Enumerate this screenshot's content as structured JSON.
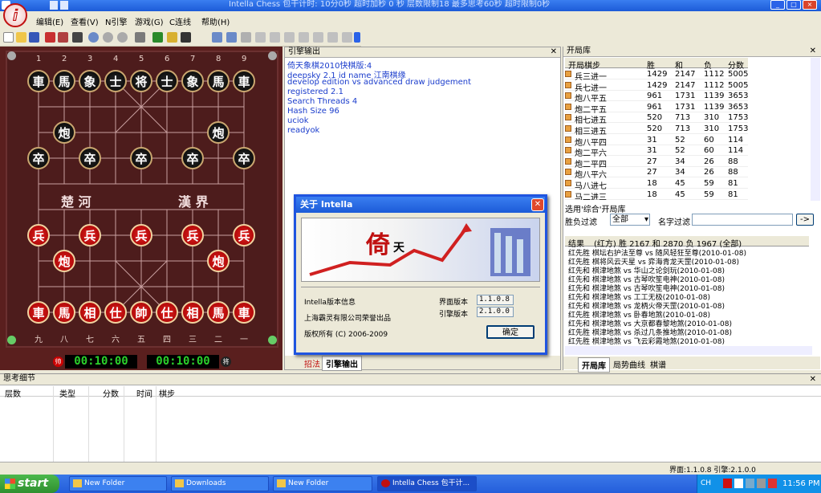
{
  "window": {
    "title": "Intella Chess 包干计时: 10分0秒 超时加秒 0 秒 层数限制18 最多思考60秒 超时限制0秒",
    "controls": [
      "_",
      "□",
      "×"
    ]
  },
  "menu": [
    "编辑(E)",
    "查看(V)",
    "N引擎",
    "游戏(G)",
    "C连线",
    "帮助(H)"
  ],
  "board": {
    "top_numbers": [
      "1",
      "2",
      "3",
      "4",
      "5",
      "6",
      "7",
      "8",
      "9"
    ],
    "bottom_numbers": [
      "九",
      "八",
      "七",
      "六",
      "五",
      "四",
      "三",
      "二",
      "一"
    ],
    "river_left": "楚 河",
    "river_right": "漢 界",
    "black_row": [
      "車",
      "馬",
      "象",
      "士",
      "将",
      "士",
      "象",
      "馬",
      "車"
    ],
    "black_cannon": [
      "炮",
      "炮"
    ],
    "black_pawn": [
      "卒",
      "卒",
      "卒",
      "卒",
      "卒"
    ],
    "red_pawn": [
      "兵",
      "兵",
      "兵",
      "兵",
      "兵"
    ],
    "red_cannon": [
      "炮",
      "炮"
    ],
    "red_row": [
      "車",
      "馬",
      "相",
      "仕",
      "帥",
      "仕",
      "相",
      "馬",
      "車"
    ],
    "clock_left": "00:10:00",
    "clock_right": "00:10:00",
    "clock_left_badge": "帅",
    "clock_right_badge": "将"
  },
  "engine": {
    "title": "引擎输出",
    "lines": [
      "倚天象棋2010快棋版:4",
      "deepsky 2.1 id name 江南棋缘",
      "develop edition vs advanced draw judgement",
      "registered 2.1",
      "Search Threads 4",
      "Hash Size 96",
      "uciok",
      "readyok"
    ],
    "tabs": [
      "招法",
      "引擎输出"
    ]
  },
  "opening": {
    "title": "开局库",
    "headers": [
      "开局棋步",
      "胜",
      "和",
      "负",
      "分数"
    ],
    "rows": [
      [
        "兵三进一",
        "1429",
        "2147",
        "1112",
        "5005"
      ],
      [
        "兵七进一",
        "1429",
        "2147",
        "1112",
        "5005"
      ],
      [
        "炮八平五",
        "961",
        "1731",
        "1139",
        "3653"
      ],
      [
        "炮二平五",
        "961",
        "1731",
        "1139",
        "3653"
      ],
      [
        "相七进五",
        "520",
        "713",
        "310",
        "1753"
      ],
      [
        "相三进五",
        "520",
        "713",
        "310",
        "1753"
      ],
      [
        "炮八平四",
        "31",
        "52",
        "60",
        "114"
      ],
      [
        "炮二平六",
        "31",
        "52",
        "60",
        "114"
      ],
      [
        "炮二平四",
        "27",
        "34",
        "26",
        "88"
      ],
      [
        "炮八平六",
        "27",
        "34",
        "26",
        "88"
      ],
      [
        "马八进七",
        "18",
        "45",
        "59",
        "81"
      ],
      [
        "马二进三",
        "18",
        "45",
        "59",
        "81"
      ]
    ],
    "filter_label": "选用'综合'开局库",
    "win_filter_label": "胜负过滤",
    "win_filter_value": "全部",
    "name_filter_label": "名字过滤",
    "go_button": "->",
    "games_header_result": "结果",
    "games_header_desc": "(红方) 胜 2167 和 2870 负 1967 (全部)",
    "games": [
      [
        "红先胜",
        "棋坛右护法至尊 vs 随风轻狂至尊(2010-01-08)"
      ],
      [
        "红先胜",
        "棋将风云天星 vs 弈海青龙天罡(2010-01-08)"
      ],
      [
        "红先和",
        "棋津地煞 vs 华山之论剑玩(2010-01-08)"
      ],
      [
        "红先和",
        "棋津地煞 vs 古琴吹笙电神(2010-01-08)"
      ],
      [
        "红先和",
        "棋津地煞 vs 古琴吹笙电神(2010-01-08)"
      ],
      [
        "红先和",
        "棋津地煞 vs 工工无极(2010-01-08)"
      ],
      [
        "红先和",
        "棋津地煞 vs 龙柄火帝天罡(2010-01-08)"
      ],
      [
        "红先胜",
        "棋津地煞 vs 卧春地煞(2010-01-08)"
      ],
      [
        "红先和",
        "棋津地煞 vs 大京都春黎地煞(2010-01-08)"
      ],
      [
        "红先胜",
        "棋津地煞 vs 杀过几条推地煞(2010-01-08)"
      ],
      [
        "红先胜",
        "棋津地煞 vs 飞云彩霞地煞(2010-01-08)"
      ]
    ],
    "tabs": [
      "开局库",
      "局势曲线",
      "棋谱"
    ]
  },
  "dialog": {
    "title": "关于 Intella",
    "logo_a": "倚",
    "logo_b": "天",
    "info_label": "Intella版本信息",
    "company": "上海霸灵有限公司荣誉出品",
    "copyright": "版权所有 (C) 2006-2009",
    "ui_version_label": "界面版本",
    "ui_version": "1.1.0.8",
    "engine_version_label": "引擎版本",
    "engine_version": "2.1.0.0",
    "ok": "确定"
  },
  "think": {
    "title": "思考细节",
    "headers": [
      "层数",
      "类型",
      "分数",
      "时间",
      "棋步"
    ]
  },
  "status": {
    "text": "界面:1.1.0.8 引擎:2.1.0.0"
  },
  "taskbar": {
    "start": "start",
    "tasks": [
      "New Folder",
      "Downloads",
      "New Folder",
      "Intella Chess 包干计..."
    ],
    "time": "11:56 PM"
  }
}
